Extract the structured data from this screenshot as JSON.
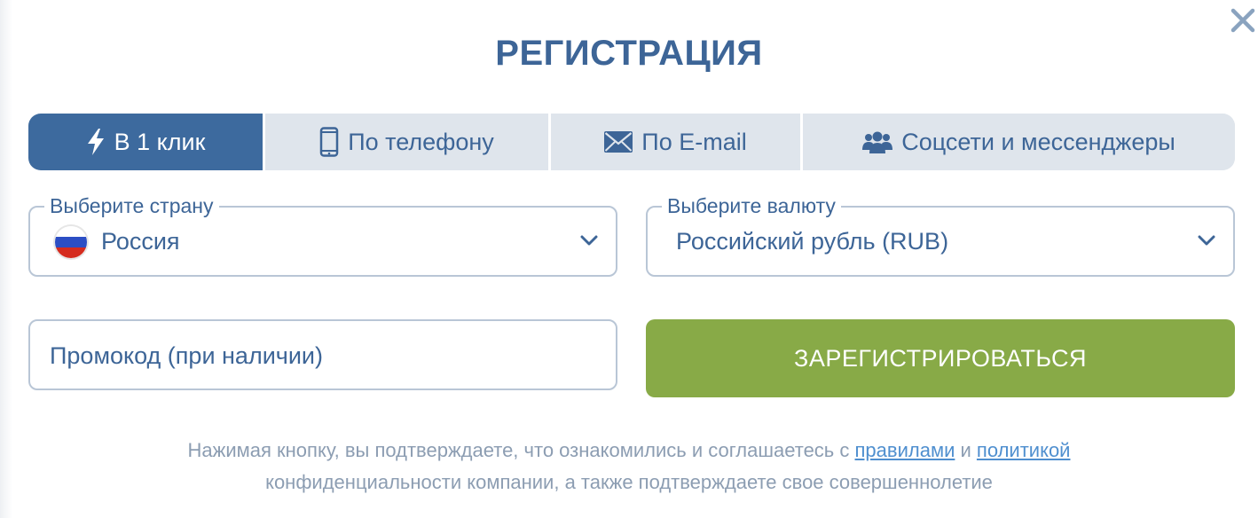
{
  "title": "РЕГИСТРАЦИЯ",
  "tabs": [
    {
      "label": "В 1 клик",
      "icon": "lightning-icon",
      "active": true
    },
    {
      "label": "По телефону",
      "icon": "phone-icon",
      "active": false
    },
    {
      "label": "По E-mail",
      "icon": "envelope-icon",
      "active": false
    },
    {
      "label": "Соцсети и мессенджеры",
      "icon": "users-icon",
      "active": false
    }
  ],
  "country": {
    "label": "Выберите страну",
    "value": "Россия",
    "flag_icon": "russia-flag-icon"
  },
  "currency": {
    "label": "Выберите валюту",
    "value": "Российский рубль (RUB)"
  },
  "promo": {
    "placeholder": "Промокод (при наличии)"
  },
  "register_button": "ЗАРЕГИСТРИРОВАТЬСЯ",
  "disclaimer": {
    "part1": "Нажимая кнопку, вы подтверждаете, что ознакомились и соглашаетесь с",
    "link_rules": "правилами",
    "and": "и",
    "link_policy": "политикой",
    "part2": "конфиденциальности компании, а также подтверждаете свое совершеннолетие"
  },
  "colors": {
    "primary": "#3d6597",
    "tab_active_bg": "#3d6a9e",
    "tab_bg": "#dfe5ec",
    "button_green": "#88aa47",
    "link": "#4f8fcf",
    "muted_text": "#8c9db2"
  }
}
